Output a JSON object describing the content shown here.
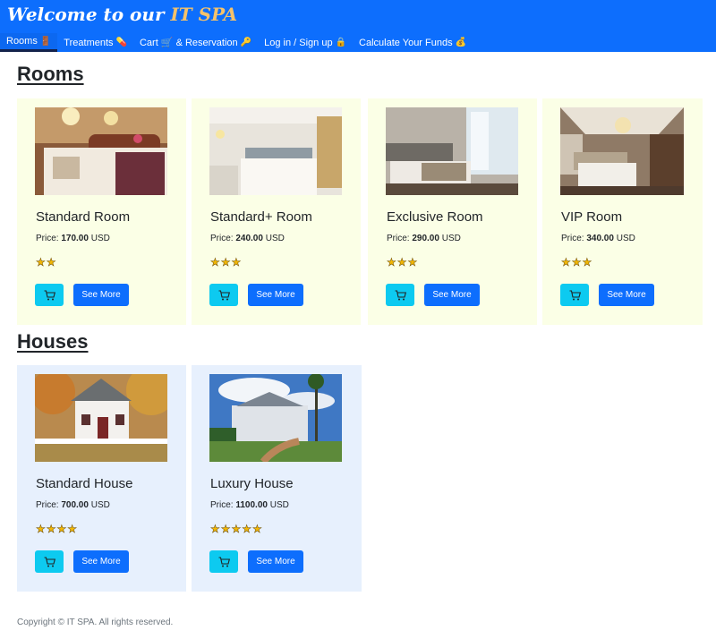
{
  "brand": {
    "prefix": "Welcome to our",
    "name": "IT SPA"
  },
  "nav": [
    {
      "label": "Rooms",
      "icon": "🚪",
      "active": true
    },
    {
      "label": "Treatments",
      "icon": "💊"
    },
    {
      "label": "Cart 🛒 & Reservation",
      "icon": "🔑"
    },
    {
      "label": "Log in / Sign up",
      "icon": "🔒"
    },
    {
      "label": "Calculate Your Funds",
      "icon": "💰"
    }
  ],
  "rooms_section": {
    "title": "Rooms",
    "items": [
      {
        "name": "Standard Room",
        "price_label": "Price:",
        "price": "170.00",
        "currency": "USD",
        "stars": "★★",
        "rating": 2
      },
      {
        "name": "Standard+ Room",
        "price_label": "Price:",
        "price": "240.00",
        "currency": "USD",
        "stars": "★★★",
        "rating": 3
      },
      {
        "name": "Exclusive Room",
        "price_label": "Price:",
        "price": "290.00",
        "currency": "USD",
        "stars": "★★★",
        "rating": 3
      },
      {
        "name": "VIP Room",
        "price_label": "Price:",
        "price": "340.00",
        "currency": "USD",
        "stars": "★★★",
        "rating": 3
      }
    ]
  },
  "houses_section": {
    "title": "Houses",
    "items": [
      {
        "name": "Standard House",
        "price_label": "Price:",
        "price": "700.00",
        "currency": "USD",
        "stars": "★★★★",
        "rating": 4
      },
      {
        "name": "Luxury House",
        "price_label": "Price:",
        "price": "1100.00",
        "currency": "USD",
        "stars": "★★★★★",
        "rating": 5
      }
    ]
  },
  "buttons": {
    "cart_icon": "cart-icon",
    "see_more": "See More"
  },
  "footer": {
    "text": "Copyright © IT SPA. All rights reserved."
  },
  "colors": {
    "primary": "#0d6efd",
    "info": "#0dcaf0",
    "room_card": "#fbffe6",
    "house_card": "#e7f0fd",
    "brand_accent": "#f5c26b"
  }
}
